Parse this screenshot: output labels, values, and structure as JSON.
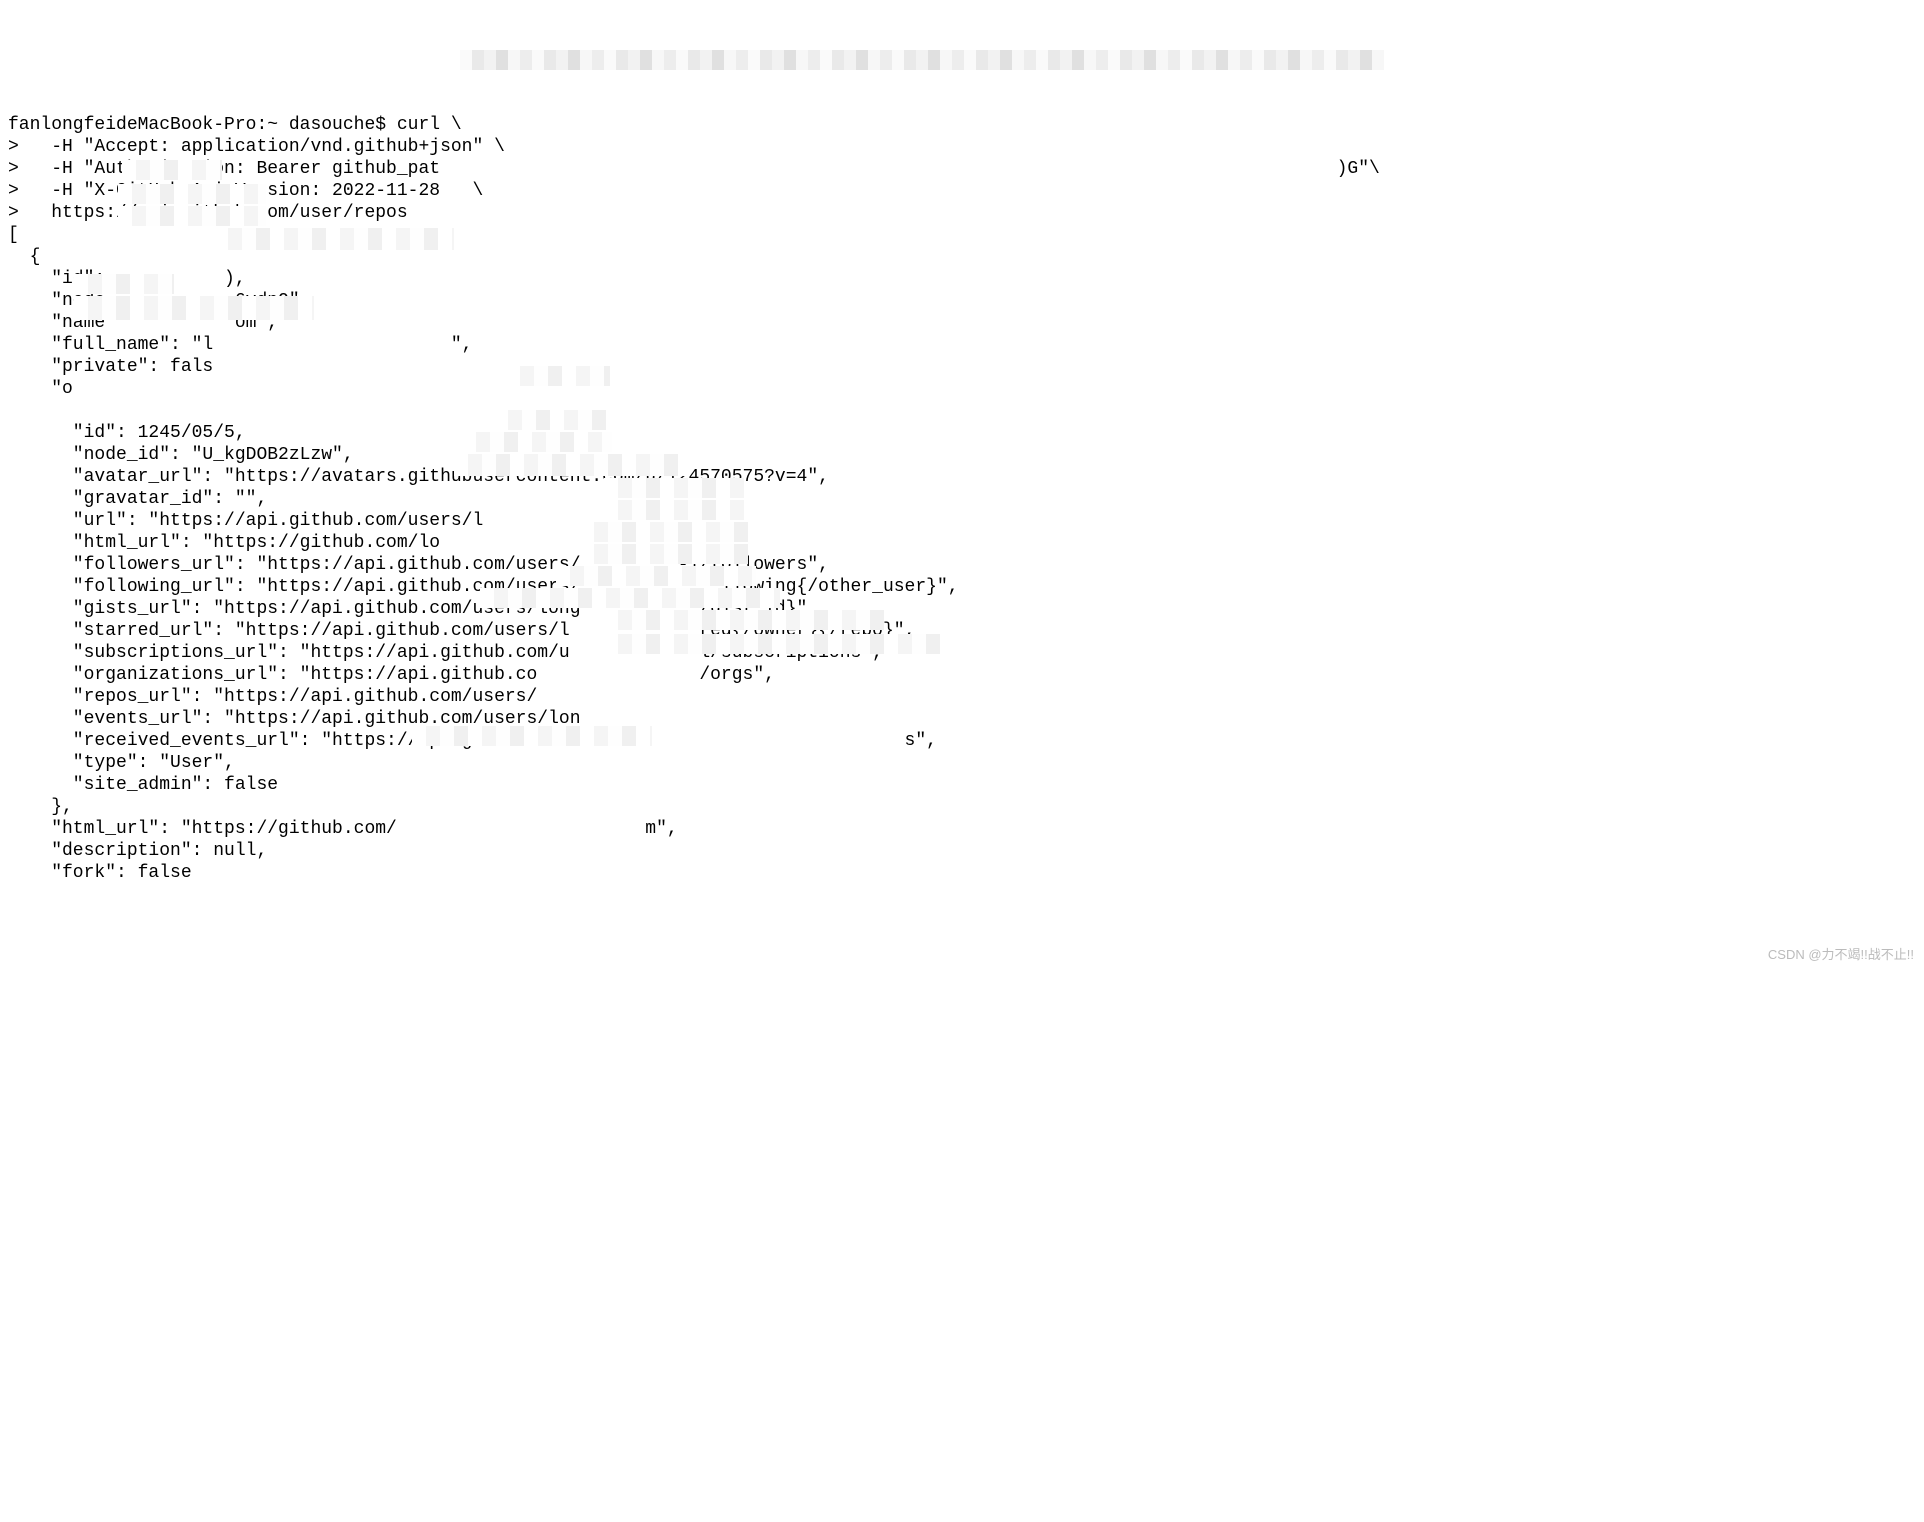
{
  "terminal": {
    "lines": {
      "l0": "fanlongfeideMacBook-Pro:~ dasouche$ curl \\",
      "l1": ">   -H \"Accept: application/vnd.github+json\" \\",
      "l2": ">   -H \"Authorization: Bearer github_pat                                                                                   )G\"\\",
      "l3": ">   -H \"X-GitHub-Api-Version: 2022-11-28   \\",
      "l4": ">   https://api.github.com/user/repos",
      "l5": "[",
      "l6": "  {",
      "l7": "    \"id\":           ),",
      "l8": "    \"node_           6vdnQ\",",
      "l9": "    \"name\"           om\",",
      "l10": "    \"full_name\": \"l                      \",",
      "l11": "    \"private\": fals",
      "l12": "    \"o",
      "l13": "      ",
      "l14": "      \"id\": 1245/05/5,",
      "l15": "      \"node_id\": \"U_kgDOB2zLzw\",",
      "l16": "      \"avatar_url\": \"https://avatars.githubusercontent.com/u/124570575?v=4\",",
      "l17": "      \"gravatar_id\": \"\",",
      "l18": "      \"url\": \"https://api.github.com/users/l          ,",
      "l19": "      \"html_url\": \"https://github.com/lo",
      "l20": "      \"followers_url\": \"https://api.github.com/users/         -1/followers\",",
      "l21": "      \"following_url\": \"https://api.github.com/users/             llowing{/other_user}\",",
      "l22": "      \"gists_url\": \"https://api.github.com/users/long           /gist_id}\",",
      "l23": "      \"starred_url\": \"https://api.github.com/users/l            red{/owner}{/repo}\",",
      "l24": "      \"subscriptions_url\": \"https://api.github.com/u            l/subscriptions\",",
      "l25": "      \"organizations_url\": \"https://api.github.co               /orgs\",",
      "l26": "      \"repos_url\": \"https://api.github.com/users/",
      "l27": "      \"events_url\": \"https://api.github.com/users/lon",
      "l28": "      \"received_events_url\": \"https://api.github.com/                              s\",",
      "l29": "      \"type\": \"User\",",
      "l30": "      \"site_admin\": false",
      "l31": "    },",
      "l32": "    \"html_url\": \"https://github.com/                       m\",",
      "l33": "    \"description\": null,",
      "l34": "    \"fork\": false"
    }
  },
  "watermark": "CSDN @力不竭!!战不止!!"
}
